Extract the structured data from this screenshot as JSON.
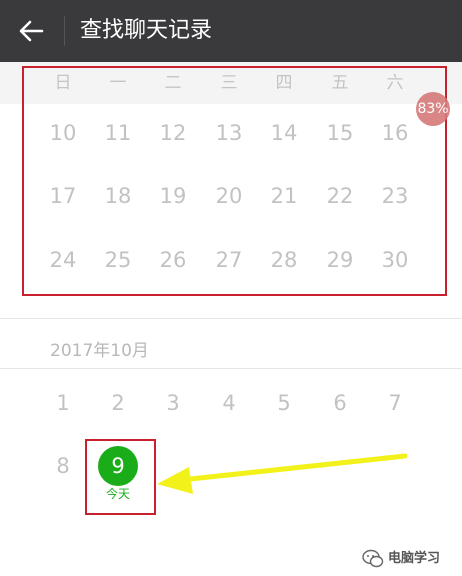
{
  "titlebar": {
    "back_icon": "arrow-left-icon",
    "title": "查找聊天记录"
  },
  "weekdays": [
    "日",
    "一",
    "二",
    "三",
    "四",
    "五",
    "六"
  ],
  "september": {
    "weeks": [
      [
        "10",
        "11",
        "12",
        "13",
        "14",
        "15",
        "16"
      ],
      [
        "17",
        "18",
        "19",
        "20",
        "21",
        "22",
        "23"
      ],
      [
        "24",
        "25",
        "26",
        "27",
        "28",
        "29",
        "30"
      ]
    ]
  },
  "badge": "83%",
  "october": {
    "label": "2017年10月",
    "week1": [
      "1",
      "2",
      "3",
      "4",
      "5",
      "6",
      "7"
    ],
    "day8": "8",
    "today_day": "9",
    "today_label": "今天"
  },
  "watermark": "电脑学习",
  "colors": {
    "titlebar_bg": "#3a3a3c",
    "today_green": "#1aad19",
    "annotation_red": "#c8202d",
    "arrow_yellow": "#f2f21a"
  }
}
